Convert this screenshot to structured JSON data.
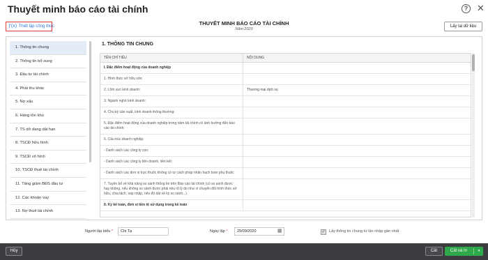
{
  "window": {
    "title": "Thuyết minh báo cáo tài chính",
    "help_icon": "?",
    "close_icon": "✕"
  },
  "toolbar": {
    "setup_label": "Thiết lập công thức",
    "reload_label": "Lấy lại dữ liệu"
  },
  "report": {
    "title": "THUYẾT MINH BÁO CÁO TÀI CHÍNH",
    "year": "Năm 2020"
  },
  "sidebar": {
    "items": [
      {
        "label": "1. Thông tin chung"
      },
      {
        "label": "2. Thông tin bổ sung"
      },
      {
        "label": "3. Đầu tư tài chính"
      },
      {
        "label": "4. Phải thu khác"
      },
      {
        "label": "5. Nợ xấu"
      },
      {
        "label": "6. Hàng tồn kho"
      },
      {
        "label": "7. TS dở dang dài hạn"
      },
      {
        "label": "8. TSCĐ hữu hình"
      },
      {
        "label": "9. TSCĐ vô hình"
      },
      {
        "label": "10. TSCĐ thuê tài chính"
      },
      {
        "label": "11. Tăng giảm BĐS đầu tư"
      },
      {
        "label": "12. Các khoản vay"
      },
      {
        "label": "13. Nợ thuê tài chính"
      }
    ]
  },
  "section": {
    "title": "1. THÔNG TIN CHUNG"
  },
  "table": {
    "col1": "TÊN CHỈ TIÊU",
    "col2": "NỘI DUNG",
    "rows": [
      {
        "name": "I. Đặc điểm hoạt động của doanh nghiệp",
        "value": ""
      },
      {
        "name": "1. Hình thức sở hữu vốn:",
        "value": ""
      },
      {
        "name": "2. Lĩnh vực kinh doanh:",
        "value": "Thương mại dịch vụ"
      },
      {
        "name": "3. Ngành nghề kinh doanh:",
        "value": ""
      },
      {
        "name": "4. Chu kỳ sản xuất, kinh doanh thông thường:",
        "value": ""
      },
      {
        "name": "5. Đặc điểm hoạt động của doanh nghiệp trong năm tài chính có ảnh hưởng đến báo cáo tài chính:",
        "value": ""
      },
      {
        "name": "6. Cấu trúc doanh nghiệp:",
        "value": ""
      },
      {
        "name": "- Danh sách các công ty con:",
        "value": ""
      },
      {
        "name": "- Danh sách các công ty liên doanh, liên kết:",
        "value": ""
      },
      {
        "name": "- Danh sách các đơn vị trực thuộc không có tư cách pháp nhân hạch toán phụ thuộc",
        "value": ""
      },
      {
        "name": "7. Tuyên bố về khả năng so sánh thông tin trên Báo cáo tài chính (có so sánh được hay không, nếu không so sánh được phải nêu rõ lý do như vì chuyển đổi hình thức sở hữu, chia tách, sáp nhập, nêu độ dài về kỳ so sánh...)",
        "value": ""
      },
      {
        "name": "II. Kỳ kế toán, đơn vị tiền tệ sử dụng trong kế toán",
        "value": ""
      }
    ]
  },
  "form": {
    "preparer_label": "Người lập biểu",
    "preparer_value": "Chi Tạ",
    "date_label": "Ngày lập",
    "date_value": "29/09/2020",
    "checkbox_label": "Lấy thông tin chung từ lần nhập gần nhất",
    "required_mark": "*"
  },
  "footer": {
    "cancel_label": "Hủy",
    "save_label": "Cất",
    "save_add_label": "Cất và In",
    "caret": "▾"
  }
}
